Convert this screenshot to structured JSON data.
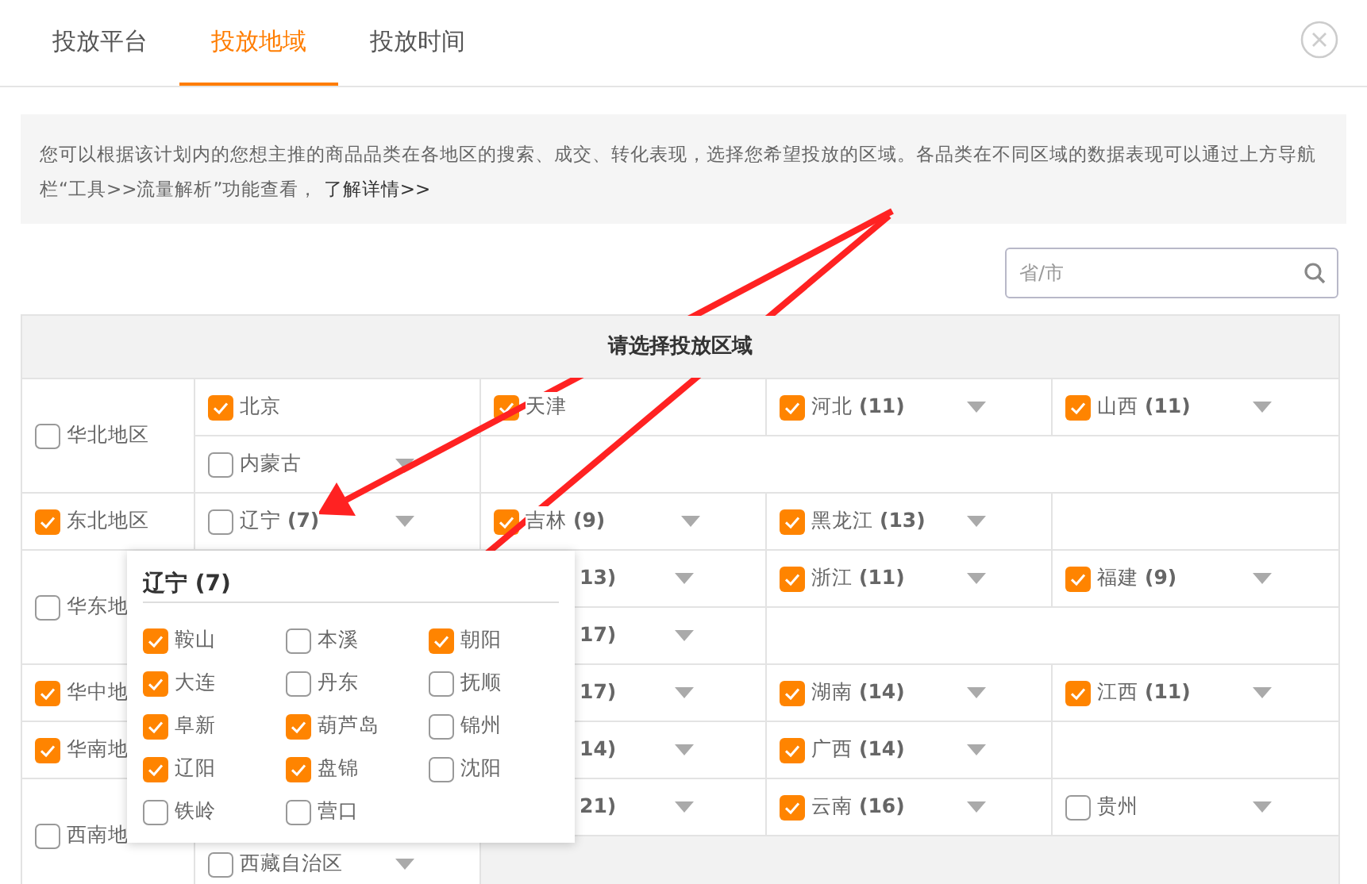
{
  "tabs": [
    {
      "label": "投放平台",
      "selected": false
    },
    {
      "label": "投放地域",
      "selected": true
    },
    {
      "label": "投放时间",
      "selected": false
    }
  ],
  "notice": {
    "text": "您可以根据该计划内的您想主推的商品品类在各地区的搜索、成交、转化表现，选择您希望投放的区域。各品类在不同区域的数据表现可以通过上方导航栏“工具>>流量解析”功能查看，",
    "link": "了解详情>>"
  },
  "search": {
    "placeholder": "省/市"
  },
  "table": {
    "header": "请选择投放区域",
    "regions": [
      {
        "name": "华北地区",
        "checked": false,
        "rows": [
          [
            {
              "kind": "province",
              "label": "北京",
              "checked": true,
              "dropdown": false
            },
            {
              "kind": "province",
              "label": "天津",
              "checked": true,
              "dropdown": false
            },
            {
              "kind": "province",
              "label": "河北 **(11)**",
              "checked": true,
              "dropdown": true
            },
            {
              "kind": "province",
              "label": "山西 **(11)**",
              "checked": true,
              "dropdown": true
            }
          ],
          [
            {
              "kind": "province",
              "label": "内蒙古",
              "checked": false,
              "dropdown": true
            }
          ]
        ]
      },
      {
        "name": "东北地区",
        "checked": true,
        "rows": [
          [
            {
              "kind": "province",
              "label": "辽宁 **(7)**",
              "checked": false,
              "dropdown": true
            },
            {
              "kind": "province",
              "label": "吉林 **(9)**",
              "checked": true,
              "dropdown": true
            },
            {
              "kind": "province",
              "label": "黑龙江 **(13)**",
              "checked": true,
              "dropdown": true
            }
          ]
        ]
      },
      {
        "name": "华东地",
        "checked": false,
        "rows": [
          [
            {
              "kind": "partial",
              "label": "**13)**",
              "dropdown": true
            },
            {
              "kind": "province",
              "label": "浙江 **(11)**",
              "checked": true,
              "dropdown": true
            },
            {
              "kind": "province",
              "label": "福建 **(9)**",
              "checked": true,
              "dropdown": true
            }
          ],
          [
            {
              "kind": "partial",
              "label": "**17)**",
              "dropdown": true
            }
          ]
        ]
      },
      {
        "name": "华中地",
        "checked": true,
        "rows": [
          [
            {
              "kind": "partial",
              "label": "**17)**",
              "dropdown": true
            },
            {
              "kind": "province",
              "label": "湖南 **(14)**",
              "checked": true,
              "dropdown": true
            },
            {
              "kind": "province",
              "label": "江西 **(11)**",
              "checked": true,
              "dropdown": true
            }
          ]
        ]
      },
      {
        "name": "华南地",
        "checked": true,
        "rows": [
          [
            {
              "kind": "partial",
              "label": "**14)**",
              "dropdown": true
            },
            {
              "kind": "province",
              "label": "广西 **(14)**",
              "checked": true,
              "dropdown": true
            }
          ]
        ]
      },
      {
        "name": "西南地",
        "checked": false,
        "rows": [
          [
            {
              "kind": "partial",
              "label": "**21)**",
              "dropdown": true
            },
            {
              "kind": "province",
              "label": "云南 **(16)**",
              "checked": true,
              "dropdown": true
            },
            {
              "kind": "province",
              "label": "贵州",
              "checked": false,
              "dropdown": true
            }
          ],
          [
            {
              "kind": "province",
              "label": "西藏自治区",
              "checked": false,
              "dropdown": true
            }
          ]
        ]
      }
    ]
  },
  "popup": {
    "title": "辽宁 (7)",
    "cities": [
      {
        "name": "鞍山",
        "checked": true
      },
      {
        "name": "本溪",
        "checked": false
      },
      {
        "name": "朝阳",
        "checked": true
      },
      {
        "name": "大连",
        "checked": true
      },
      {
        "name": "丹东",
        "checked": false
      },
      {
        "name": "抚顺",
        "checked": false
      },
      {
        "name": "阜新",
        "checked": true
      },
      {
        "name": "葫芦岛",
        "checked": true
      },
      {
        "name": "锦州",
        "checked": false
      },
      {
        "name": "辽阳",
        "checked": true
      },
      {
        "name": "盘锦",
        "checked": true
      },
      {
        "name": "沈阳",
        "checked": false
      },
      {
        "name": "铁岭",
        "checked": false
      },
      {
        "name": "营口",
        "checked": false
      }
    ]
  }
}
